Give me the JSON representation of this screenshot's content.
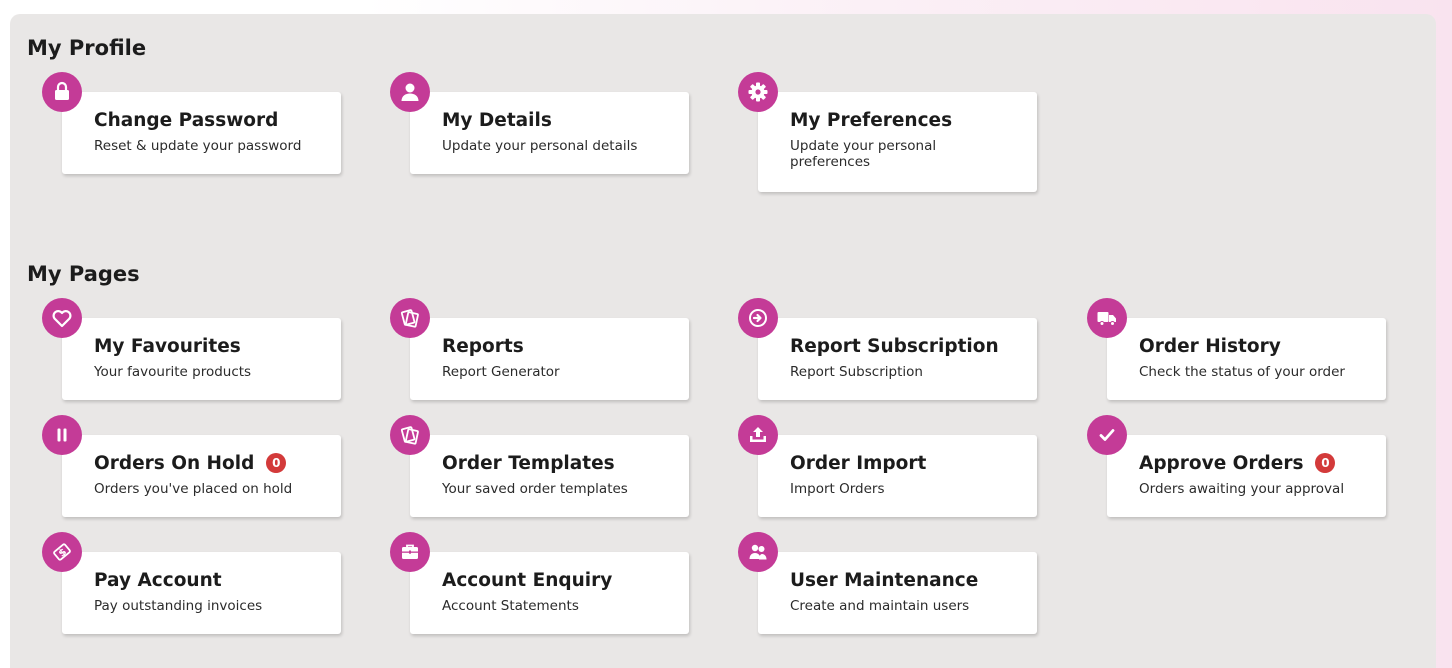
{
  "sections": {
    "profile": {
      "title": "My Profile"
    },
    "pages": {
      "title": "My Pages"
    }
  },
  "accent_color": "#c43b97",
  "badge_color": "#d33a3a",
  "cards": {
    "change_password": {
      "title": "Change Password",
      "desc": "Reset & update your password",
      "icon": "lock-icon"
    },
    "my_details": {
      "title": "My Details",
      "desc": "Update your personal details",
      "icon": "user-icon"
    },
    "my_preferences": {
      "title": "My Preferences",
      "desc": "Update your personal preferences",
      "icon": "gear-icon"
    },
    "my_favourites": {
      "title": "My Favourites",
      "desc": "Your favourite products",
      "icon": "heart-icon"
    },
    "reports": {
      "title": "Reports",
      "desc": "Report Generator",
      "icon": "documents-icon"
    },
    "report_subscription": {
      "title": "Report Subscription",
      "desc": "Report Subscription",
      "icon": "arrow-circle-icon"
    },
    "order_history": {
      "title": "Order History",
      "desc": "Check the status of your order",
      "icon": "truck-icon"
    },
    "orders_on_hold": {
      "title": "Orders On Hold",
      "badge": "0",
      "desc": "Orders you've placed on hold",
      "icon": "pause-icon"
    },
    "order_templates": {
      "title": "Order Templates",
      "desc": "Your saved order templates",
      "icon": "documents-icon"
    },
    "order_import": {
      "title": "Order Import",
      "desc": "Import Orders",
      "icon": "upload-icon"
    },
    "approve_orders": {
      "title": "Approve Orders",
      "badge": "0",
      "desc": "Orders awaiting your approval",
      "icon": "checkmark-icon"
    },
    "pay_account": {
      "title": "Pay Account",
      "desc": "Pay outstanding invoices",
      "icon": "payment-icon"
    },
    "account_enquiry": {
      "title": "Account Enquiry",
      "desc": "Account Statements",
      "icon": "briefcase-icon"
    },
    "user_maintenance": {
      "title": "User Maintenance",
      "desc": "Create and maintain users",
      "icon": "users-icon"
    }
  }
}
